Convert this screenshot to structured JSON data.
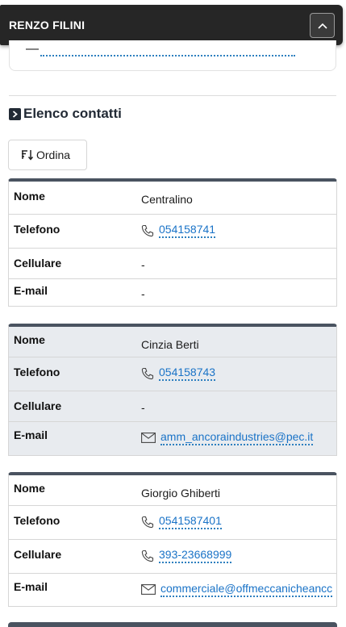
{
  "header": {
    "title": "RENZO FILINI",
    "toggle_icon": "chevron-up-icon"
  },
  "section": {
    "title": "Elenco contatti",
    "sort_label": "Ordina"
  },
  "labels": {
    "name": "Nome",
    "phone": "Telefono",
    "mobile": "Cellulare",
    "email": "E-mail"
  },
  "contacts": [
    {
      "name": "Centralino",
      "phone": "054158741",
      "mobile": "-",
      "email": "-"
    },
    {
      "name": "Cinzia Berti",
      "phone": "054158743",
      "mobile": "-",
      "email": "amm_ancoraindustries@pec.it"
    },
    {
      "name": "Giorgio Ghiberti",
      "phone": "0541587401",
      "mobile": "393-23668999",
      "email": "commerciale@offmeccanicheancc"
    }
  ],
  "colors": {
    "header_bg": "#262626",
    "link": "#1a73c7",
    "card_border": "#4a5360",
    "shaded_card": "#e8ebef"
  }
}
